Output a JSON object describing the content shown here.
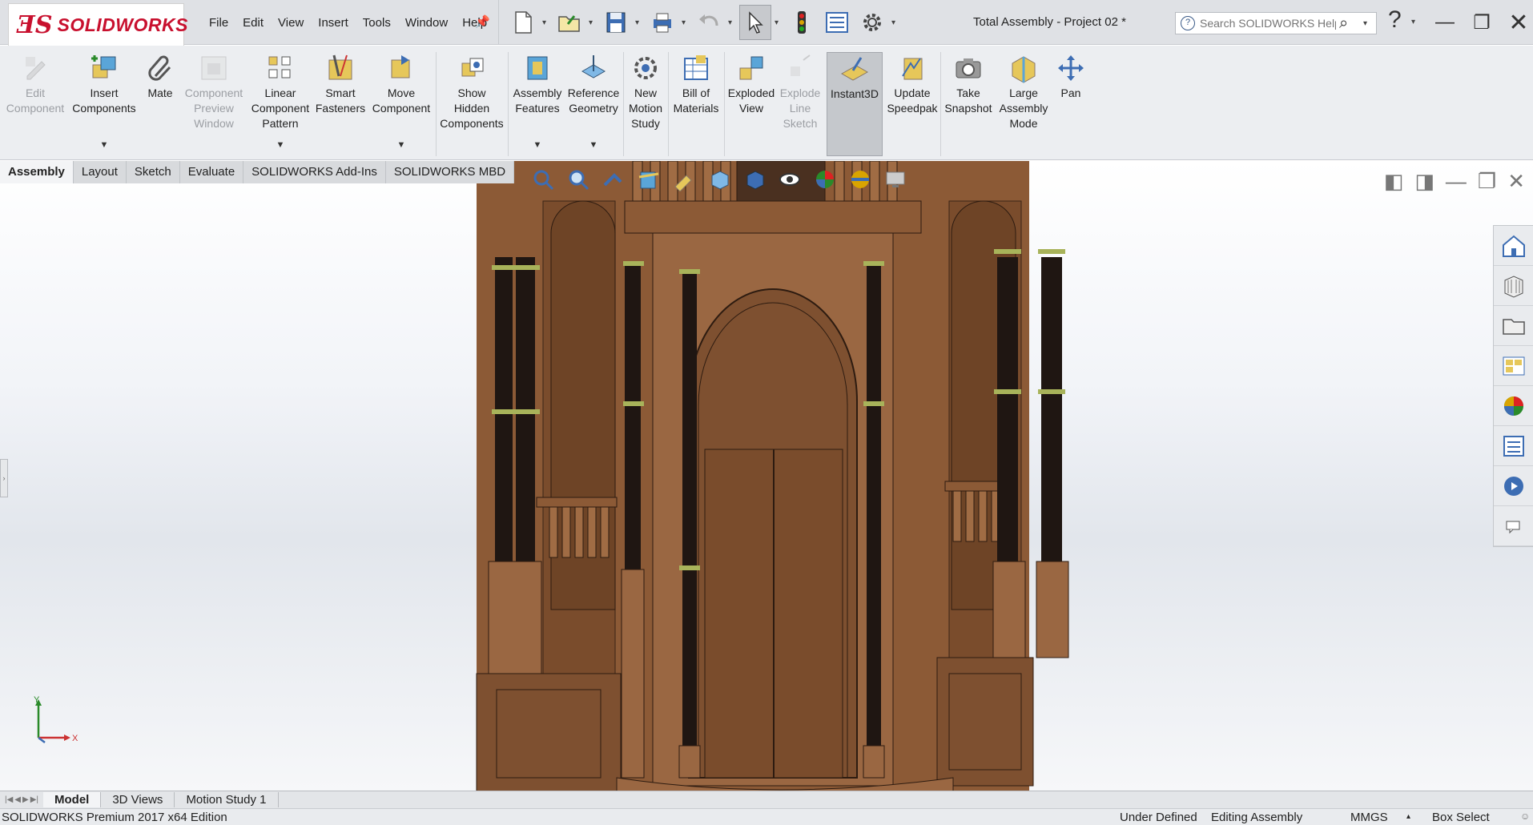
{
  "app": {
    "logo_ds": "ƎS",
    "logo_word": "SOLIDWORKS",
    "document_title": "Total Assembly - Project 02 *"
  },
  "menu": [
    "File",
    "Edit",
    "View",
    "Insert",
    "Tools",
    "Window",
    "Help"
  ],
  "search": {
    "placeholder": "Search SOLIDWORKS Help"
  },
  "ribbon": {
    "edit_component": "Edit\nComponent",
    "insert_components": "Insert\nComponents",
    "mate": "Mate",
    "component_preview": "Component\nPreview\nWindow",
    "linear_pattern": "Linear\nComponent\nPattern",
    "smart_fasteners": "Smart\nFasteners",
    "move_component": "Move\nComponent",
    "show_hidden": "Show\nHidden\nComponents",
    "assembly_features": "Assembly\nFeatures",
    "reference_geometry": "Reference\nGeometry",
    "new_motion_study": "New\nMotion\nStudy",
    "bill_of_materials": "Bill of\nMaterials",
    "exploded_view": "Exploded\nView",
    "explode_line_sketch": "Explode\nLine\nSketch",
    "instant3d": "Instant3D",
    "update_speedpak": "Update\nSpeedpak",
    "take_snapshot": "Take\nSnapshot",
    "large_assembly_mode": "Large\nAssembly\nMode",
    "pan": "Pan"
  },
  "tabs": [
    "Assembly",
    "Layout",
    "Sketch",
    "Evaluate",
    "SOLIDWORKS Add-Ins",
    "SOLIDWORKS MBD"
  ],
  "active_tab": "Assembly",
  "bottom_tabs": [
    "Model",
    "3D Views",
    "Motion Study 1"
  ],
  "active_bottom_tab": "Model",
  "triad": {
    "y": "Y",
    "x": "X"
  },
  "status": {
    "edition": "SOLIDWORKS Premium 2017 x64 Edition",
    "definition": "Under Defined",
    "mode": "Editing Assembly",
    "units": "MMGS",
    "units_caret": "▴",
    "select": "Box Select"
  },
  "colors": {
    "wood": "#8c5a36",
    "wood_dark": "#6e4426",
    "column_dark": "#1f1612",
    "brass": "#a8b35a",
    "brand": "#c8102e"
  }
}
